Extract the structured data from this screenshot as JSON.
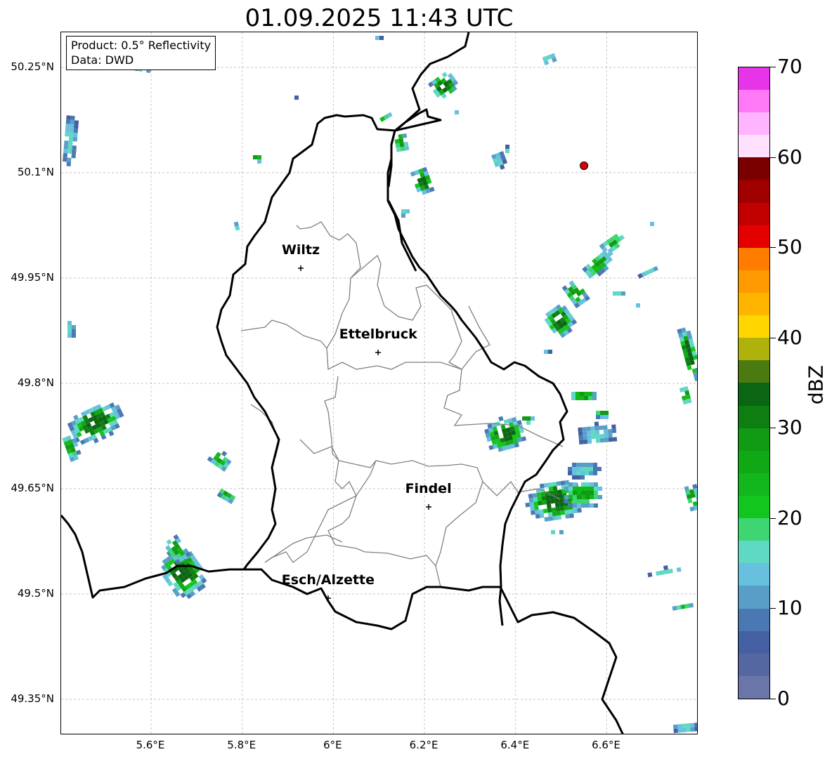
{
  "title": "01.09.2025 11:43 UTC",
  "info": {
    "product": "Product: 0.5° Reflectivity",
    "data": "Data: DWD"
  },
  "map": {
    "lat_ticks": [
      "50.25°N",
      "50.1°N",
      "49.95°N",
      "49.8°N",
      "49.65°N",
      "49.5°N",
      "49.35°N"
    ],
    "lon_ticks": [
      "5.6°E",
      "5.8°E",
      "6°E",
      "6.2°E",
      "6.4°E",
      "6.6°E"
    ],
    "cities": [
      {
        "name": "Wiltz",
        "lon": 5.93,
        "lat": 49.97
      },
      {
        "name": "Ettelbruck",
        "lon": 6.1,
        "lat": 49.85
      },
      {
        "name": "Findel",
        "lon": 6.21,
        "lat": 49.63
      },
      {
        "name": "Esch/Alzette",
        "lon": 5.99,
        "lat": 49.5
      }
    ],
    "radar_site": {
      "lon": 6.55,
      "lat": 50.11,
      "color": "#e00000"
    }
  },
  "colorbar": {
    "label": "dBZ",
    "tick_labels": [
      "0",
      "10",
      "20",
      "30",
      "40",
      "50",
      "60",
      "70"
    ],
    "range": [
      0,
      70
    ],
    "colors": [
      "#6a76a8",
      "#5567a0",
      "#445fa2",
      "#4a78b2",
      "#589ec6",
      "#66c0de",
      "#5fd8c4",
      "#3ed673",
      "#13c61f",
      "#12b81b",
      "#11a816",
      "#119a14",
      "#0e7e13",
      "#0b6613",
      "#4a7a10",
      "#b0b20c",
      "#ffd600",
      "#ffb400",
      "#ff9b00",
      "#ff7c00",
      "#e50000",
      "#c30000",
      "#a00000",
      "#7a0000",
      "#ffe0ff",
      "#ffb4ff",
      "#ff78f6",
      "#e834e8"
    ]
  },
  "colors": {
    "border": "#000000",
    "admin": "#808080",
    "grid": "#b0b0b0"
  }
}
